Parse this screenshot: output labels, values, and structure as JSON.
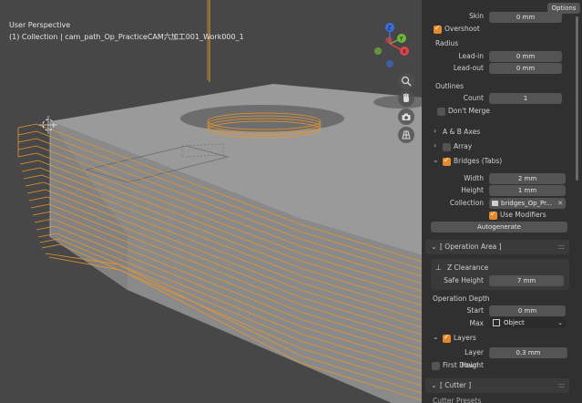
{
  "viewport": {
    "perspective_label": "User Perspective",
    "collection_label": "(1) Collection | cam_path_Op_PracticeCAM六加工001_Work000_1",
    "gizmo": {
      "z": "Z",
      "y": "Y",
      "x": "X"
    }
  },
  "header": {
    "options_label": "Options"
  },
  "panel": {
    "skin_label": "Skin",
    "skin_value": "0 mm",
    "overshoot_label": "Overshoot",
    "radius_label": "Radius",
    "lead_in_label": "Lead-in",
    "lead_in_value": "0 mm",
    "lead_out_label": "Lead-out",
    "lead_out_value": "0 mm",
    "outlines_label": "Outlines",
    "count_label": "Count",
    "count_value": "1",
    "dont_merge_label": "Don't Merge",
    "ab_axes_label": "A & B Axes",
    "array_label": "Array",
    "bridges_label": "Bridges (Tabs)",
    "width_label": "Width",
    "width_value": "2 mm",
    "height_label": "Height",
    "height_value": "1 mm",
    "collection_label": "Collection",
    "collection_value": "bridges_Op_Pr...",
    "use_modifiers_label": "Use Modifiers",
    "autogenerate_label": "Autogenerate",
    "operation_area_label": "[ Operation Area ]",
    "z_clearance_label": "Z Clearance",
    "safe_height_label": "Safe Height",
    "safe_height_value": "7 mm",
    "operation_depth_label": "Operation Depth",
    "start_label": "Start",
    "start_value": "0 mm",
    "max_label": "Max",
    "max_value": "Object",
    "layers_label": "Layers",
    "layer_height_label": "Layer Height",
    "layer_height_value": "0.3 mm",
    "first_down_label": "First Down",
    "cutter_label": "[ Cutter ]",
    "cutter_presets_label": "Cutter Presets"
  },
  "colors": {
    "accent": "#e5892a",
    "panel_bg": "#303030",
    "viewport_bg": "#474747",
    "toolpath": "#e8962d"
  }
}
